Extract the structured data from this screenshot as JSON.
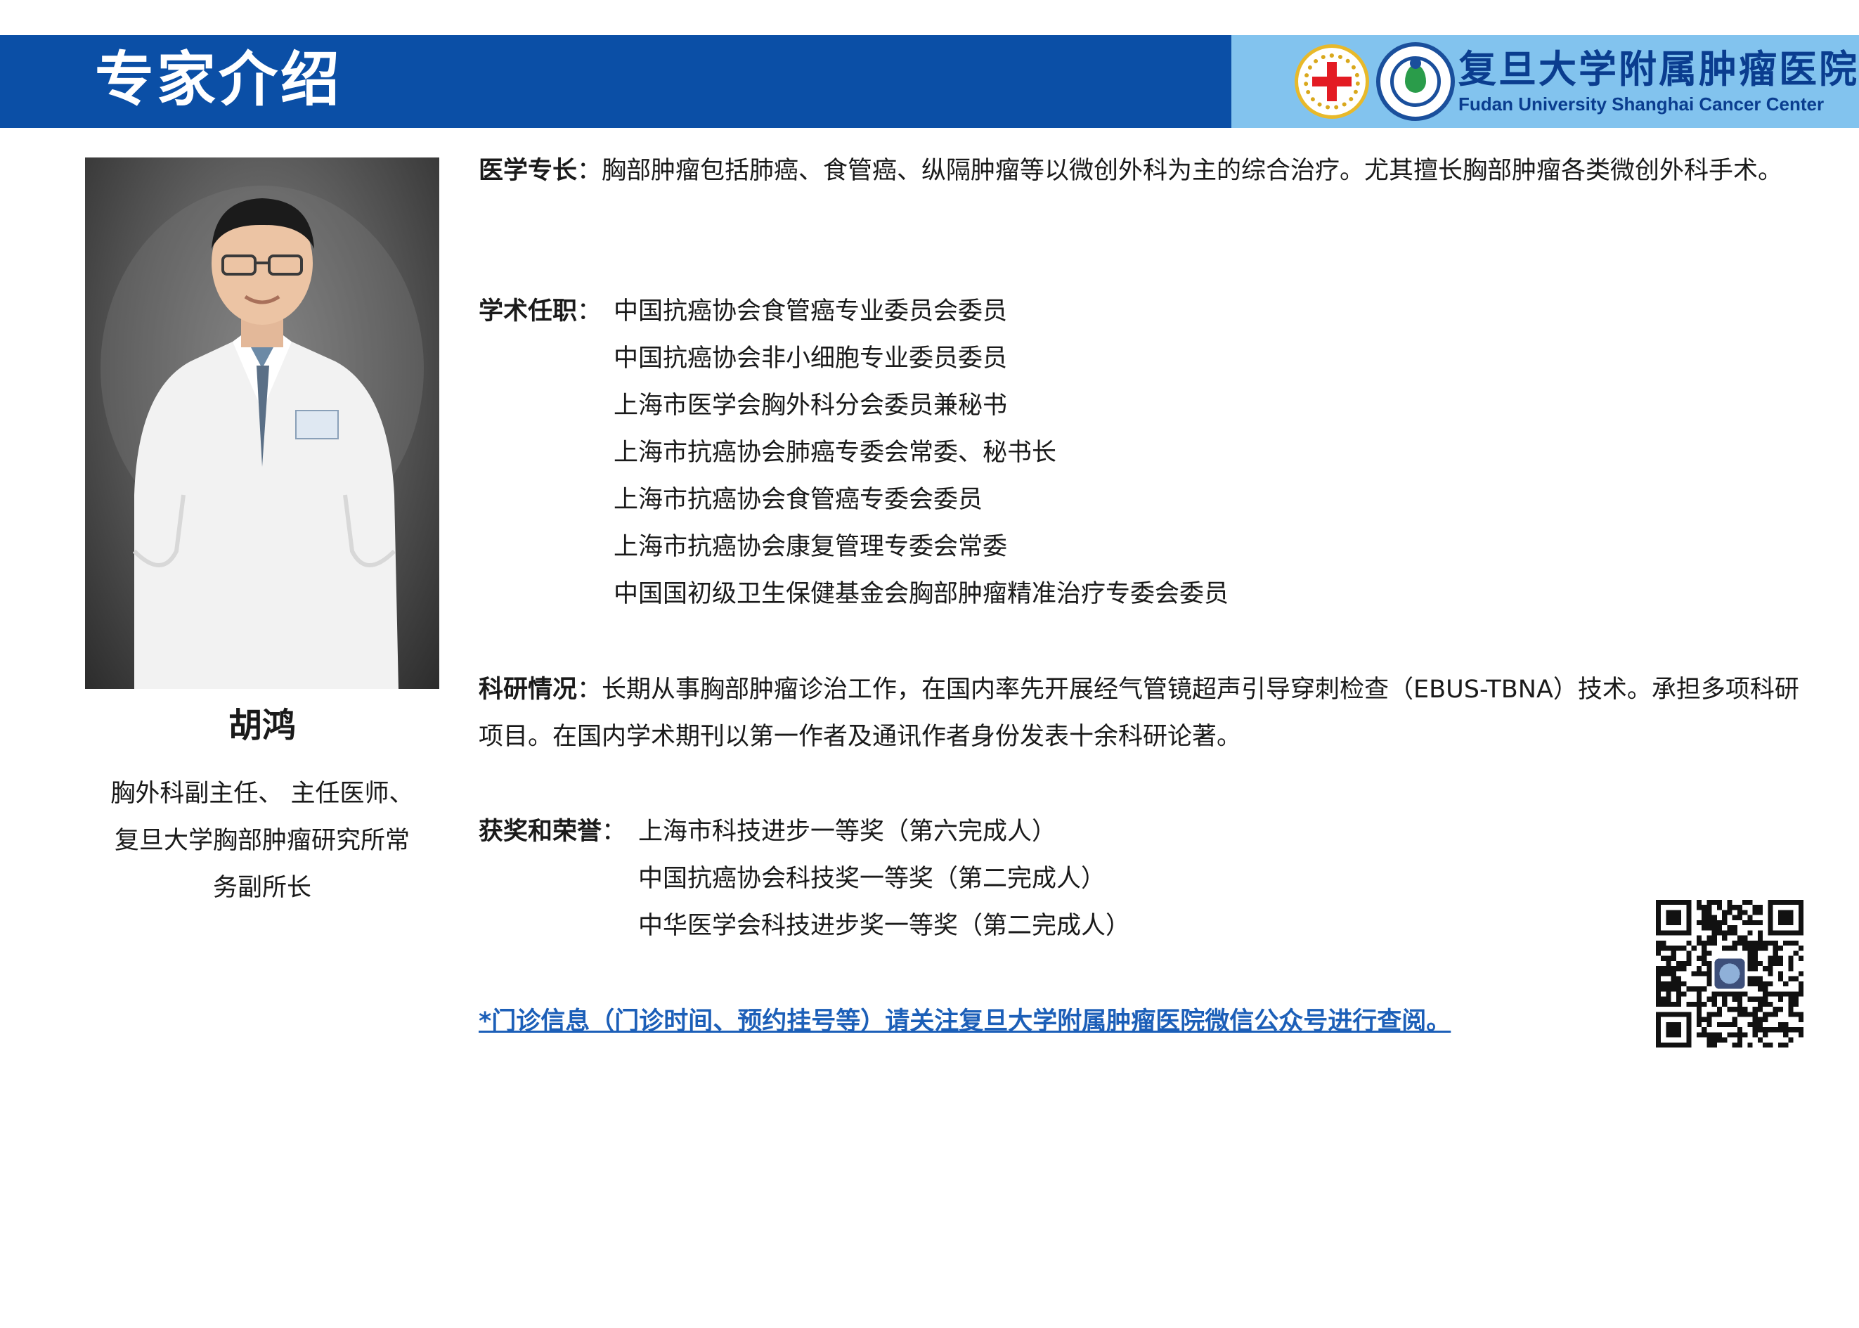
{
  "header": {
    "title": "专家介绍",
    "hospital_name_cn": "复旦大学附属肿瘤医院",
    "hospital_name_en": "Fudan University Shanghai Cancer Center",
    "bar_color": "#0b4fa6",
    "logo_panel_color": "#82c3ee"
  },
  "profile": {
    "name": "胡鸿",
    "title_lines": [
      "胸外科副主任、 主任医师、",
      "复旦大学胸部肿瘤研究所常",
      "务副所长"
    ]
  },
  "specialty": {
    "label": "医学专长",
    "text": "胸部肿瘤包括肺癌、食管癌、纵隔肿瘤等以微创外科为主的综合治疗。尤其擅长胸部肿瘤各类微创外科手术。"
  },
  "positions": {
    "label": "学术任职",
    "items": [
      "中国抗癌协会食管癌专业委员会委员",
      "中国抗癌协会非小细胞专业委员委员",
      "上海市医学会胸外科分会委员兼秘书",
      "上海市抗癌协会肺癌专委会常委、秘书长",
      "上海市抗癌协会食管癌专委会委员",
      "上海市抗癌协会康复管理专委会常委",
      "中国国初级卫生保健基金会胸部肿瘤精准治疗专委会委员"
    ]
  },
  "research": {
    "label": "科研情况",
    "text": "长期从事胸部肿瘤诊治工作，在国内率先开展经气管镜超声引导穿刺检查（EBUS-TBNA）技术。承担多项科研项目。在国内学术期刊以第一作者及通讯作者身份发表十余科研论著。"
  },
  "awards": {
    "label": "获奖和荣誉",
    "items": [
      "上海市科技进步一等奖（第六完成人）",
      "中国抗癌协会科技奖一等奖（第二完成人）",
      "中华医学会科技进步奖一等奖（第二完成人）"
    ]
  },
  "notice": {
    "text": "*门诊信息（门诊时间、预约挂号等）请关注复旦大学附属肿瘤医院微信公众号进行查阅。",
    "color": "#1c5fb8"
  },
  "icons": {
    "red_cross": "red-cross-emblem-icon",
    "hospital": "hospital-emblem-icon",
    "qr": "qr-code-icon"
  }
}
